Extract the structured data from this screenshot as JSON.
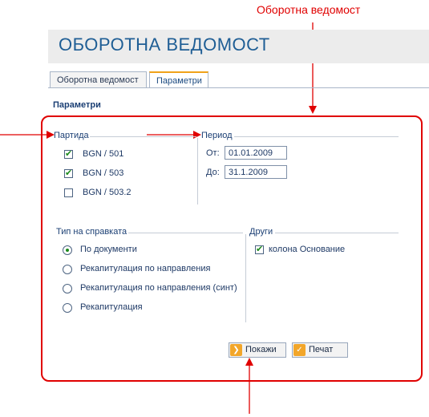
{
  "annotation": {
    "caption": "Оборотна ведомост"
  },
  "header": {
    "title": "ОБОРОТНА ВЕДОМОСТ"
  },
  "tabs": [
    {
      "label": "Оборотна ведомост",
      "active": false
    },
    {
      "label": "Параметри",
      "active": true
    }
  ],
  "section": {
    "title": "Параметри"
  },
  "party": {
    "legend": "Партида",
    "items": [
      {
        "label": "BGN / 501",
        "checked": true
      },
      {
        "label": "BGN / 503",
        "checked": true
      },
      {
        "label": "BGN / 503.2",
        "checked": false
      }
    ]
  },
  "period": {
    "legend": "Период",
    "from_label": "От:",
    "from_value": "01.01.2009",
    "to_label": "До:",
    "to_value": "31.1.2009"
  },
  "report_type": {
    "legend": "Тип на справката",
    "options": [
      {
        "label": "По документи",
        "selected": true
      },
      {
        "label": "Рекапитулация по направления",
        "selected": false
      },
      {
        "label": "Рекапитулация по направления (синт)",
        "selected": false
      },
      {
        "label": "Рекапитулация",
        "selected": false
      }
    ]
  },
  "other": {
    "legend": "Други",
    "items": [
      {
        "label": "колона Основание",
        "checked": true
      }
    ]
  },
  "buttons": {
    "show": "Покажи",
    "print": "Печат"
  },
  "colors": {
    "annotation": "#e00000",
    "title": "#1f5e95",
    "accent": "#f2a62a",
    "check": "#1c8a1c"
  }
}
